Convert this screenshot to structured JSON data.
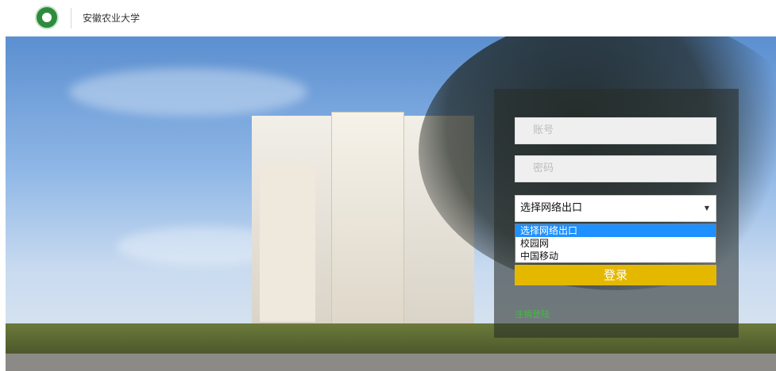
{
  "header": {
    "school_name": "安徽农业大学"
  },
  "form": {
    "account_placeholder": "账号",
    "password_placeholder": "密码",
    "select_value": "选择网络出口",
    "options": [
      "选择网络出口",
      "校园网",
      "中国移动"
    ],
    "login_label": "登录",
    "logout_link": "注销登陆"
  },
  "colors": {
    "accent": "#e5b800",
    "link": "#3fbf3f",
    "selection": "#1e90ff"
  }
}
